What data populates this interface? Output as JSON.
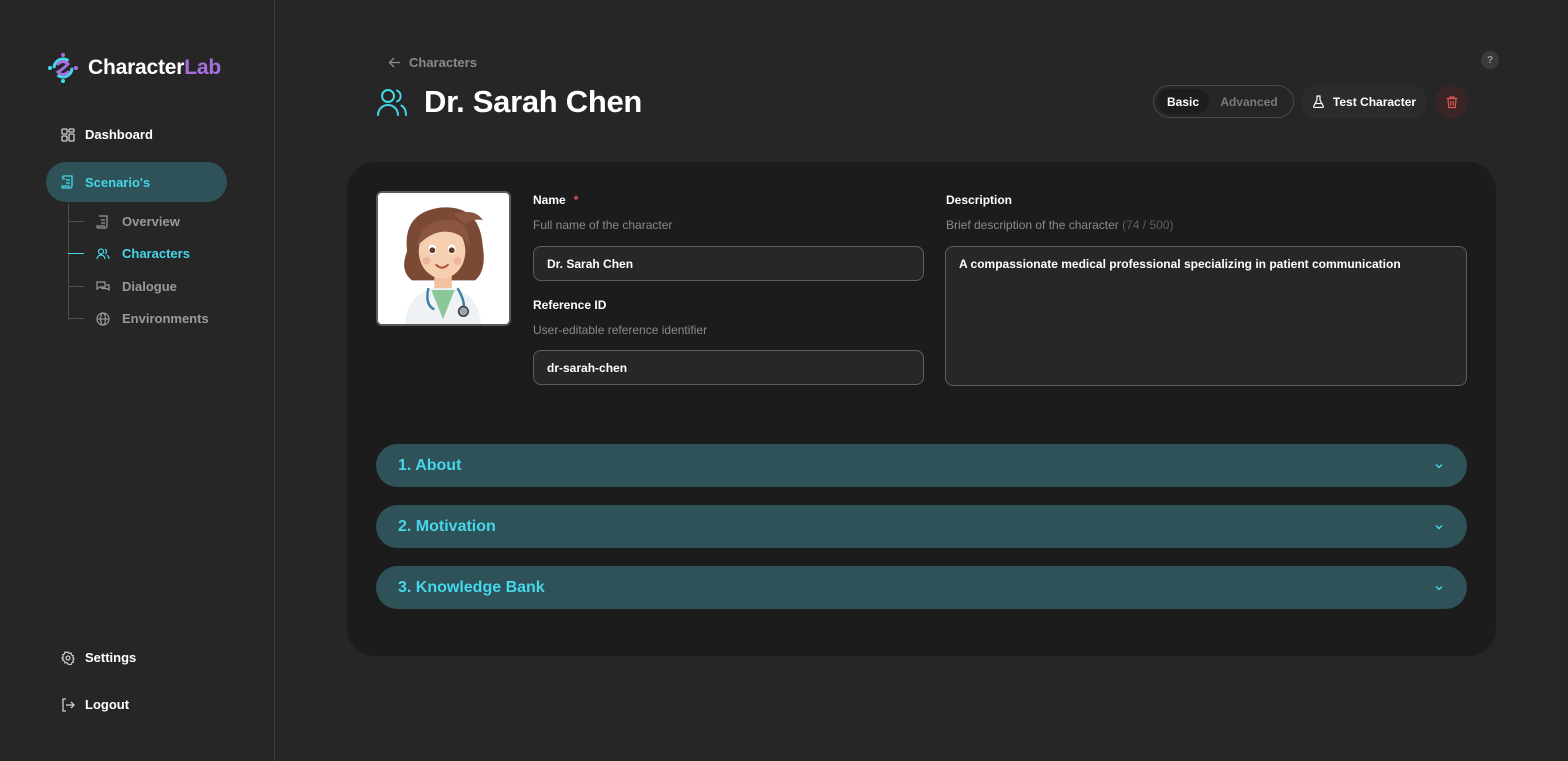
{
  "app": {
    "logo_prefix": "Character",
    "logo_suffix": "Lab"
  },
  "sidebar": {
    "dashboard": "Dashboard",
    "scenarios": "Scenario's",
    "sub_items": {
      "overview": "Overview",
      "characters": "Characters",
      "dialogue": "Dialogue",
      "environments": "Environments"
    },
    "settings": "Settings",
    "logout": "Logout"
  },
  "header": {
    "breadcrumb": "Characters",
    "title": "Dr. Sarah Chen",
    "help": "?",
    "mode_basic": "Basic",
    "mode_advanced": "Advanced",
    "active_mode": "Basic",
    "test_button": "Test Character"
  },
  "form": {
    "name": {
      "label": "Name",
      "required_mark": "*",
      "hint": "Full name of the character",
      "value": "Dr. Sarah Chen"
    },
    "reference_id": {
      "label": "Reference ID",
      "hint": "User-editable reference identifier",
      "value": "dr-sarah-chen"
    },
    "description": {
      "label": "Description",
      "hint": "Brief description of the character",
      "count": "(74 / 500)",
      "value": "A compassionate medical professional specializing in patient communication"
    }
  },
  "sections": [
    {
      "title": "1. About"
    },
    {
      "title": "2. Motivation"
    },
    {
      "title": "3. Knowledge Bank"
    }
  ],
  "colors": {
    "accent": "#45d7ea",
    "accent_bg": "#2f5158",
    "brand_purple": "#a86ee0",
    "danger": "#e05555"
  }
}
